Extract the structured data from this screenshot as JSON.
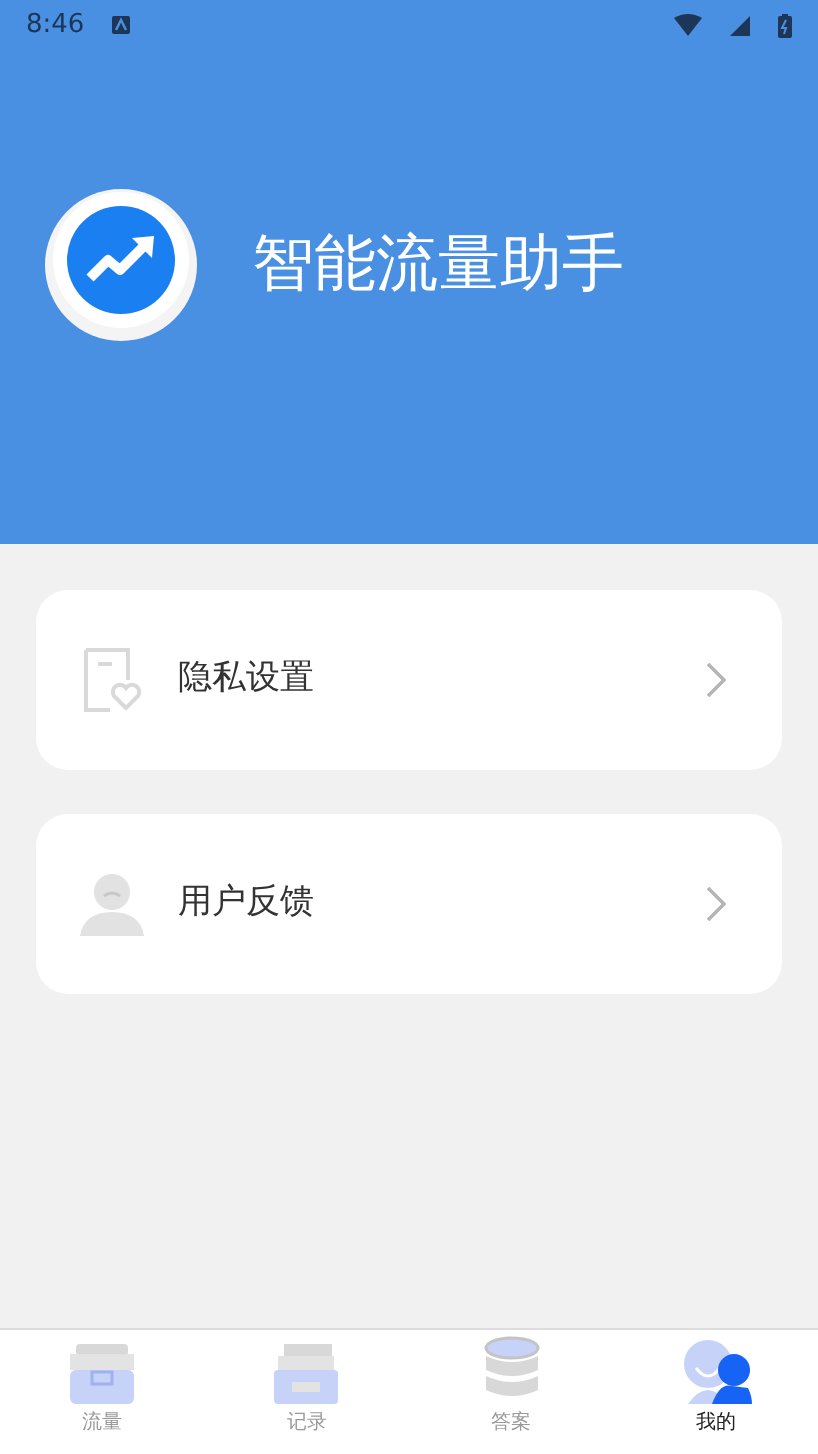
{
  "status_bar": {
    "time": "8:46"
  },
  "header": {
    "title": "智能流量助手"
  },
  "menu": [
    {
      "kind": "privacy",
      "label": "隐私设置"
    },
    {
      "kind": "feedback",
      "label": "用户反馈"
    }
  ],
  "nav": [
    {
      "kind": "box",
      "label": "流量",
      "selected": false
    },
    {
      "kind": "files",
      "label": "记录",
      "selected": false
    },
    {
      "kind": "stack",
      "label": "答案",
      "selected": false
    },
    {
      "kind": "user",
      "label": "我的",
      "selected": true
    }
  ]
}
